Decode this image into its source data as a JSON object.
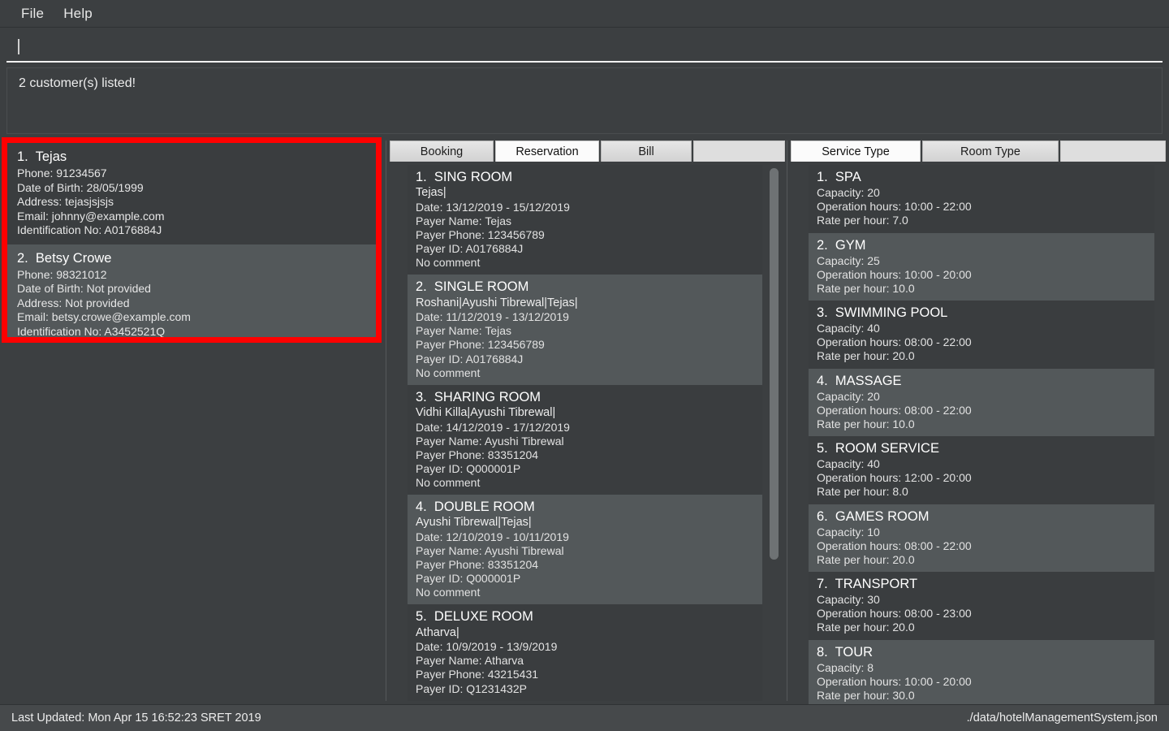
{
  "menubar": {
    "items": [
      "File",
      "Help"
    ]
  },
  "command": {
    "value": "",
    "placeholder": ""
  },
  "message": {
    "text": "2 customer(s) listed!"
  },
  "customer_panel": {
    "selected": true,
    "highlight_color": "#ff0000",
    "customers": [
      {
        "title": "1.  Tejas",
        "phone": "Phone: 91234567",
        "dob": "Date of Birth: 28/05/1999",
        "address": "Address: tejasjsjsjs",
        "email": "Email: johnny@example.com",
        "id": "Identification No: A0176884J"
      },
      {
        "title": "2.  Betsy Crowe",
        "phone": "Phone: 98321012",
        "dob": "Date of Birth: Not provided",
        "address": "Address: Not provided",
        "email": "Email: betsy.crowe@example.com",
        "id": "Identification No: A3452521Q"
      }
    ]
  },
  "middle_panel": {
    "tabs": [
      {
        "label": "Booking",
        "selected": false
      },
      {
        "label": "Reservation",
        "selected": true
      },
      {
        "label": "Bill",
        "selected": false
      }
    ],
    "reservations": [
      {
        "title": "1.  SING ROOM",
        "occupants": "Tejas|",
        "date": "Date: 13/12/2019 - 15/12/2019",
        "payer_name": "Payer Name: Tejas",
        "payer_phone": "Payer Phone: 123456789",
        "payer_id": "Payer ID: A0176884J",
        "comment": "No comment"
      },
      {
        "title": "2.  SINGLE ROOM",
        "occupants": "Roshani|Ayushi Tibrewal|Tejas|",
        "date": "Date: 11/12/2019 - 13/12/2019",
        "payer_name": "Payer Name: Tejas",
        "payer_phone": "Payer Phone: 123456789",
        "payer_id": "Payer ID: A0176884J",
        "comment": "No comment"
      },
      {
        "title": "3.  SHARING ROOM",
        "occupants": "Vidhi Killa|Ayushi Tibrewal|",
        "date": "Date: 14/12/2019 - 17/12/2019",
        "payer_name": "Payer Name: Ayushi Tibrewal",
        "payer_phone": "Payer Phone: 83351204",
        "payer_id": "Payer ID: Q000001P",
        "comment": "No comment"
      },
      {
        "title": "4.  DOUBLE ROOM",
        "occupants": "Ayushi Tibrewal|Tejas|",
        "date": "Date: 12/10/2019 - 10/11/2019",
        "payer_name": "Payer Name: Ayushi Tibrewal",
        "payer_phone": "Payer Phone: 83351204",
        "payer_id": "Payer ID: Q000001P",
        "comment": "No comment"
      },
      {
        "title": "5.  DELUXE ROOM",
        "occupants": "Atharva|",
        "date": "Date: 10/9/2019 - 13/9/2019",
        "payer_name": "Payer Name: Atharva",
        "payer_phone": "Payer Phone: 43215431",
        "payer_id": "Payer ID: Q1231432P",
        "comment": ""
      }
    ]
  },
  "right_panel": {
    "tabs": [
      {
        "label": "Service Type",
        "selected": true
      },
      {
        "label": "Room Type",
        "selected": false
      }
    ],
    "services": [
      {
        "title": "1.  SPA",
        "capacity": "Capacity: 20",
        "hours": "Operation hours: 10:00 - 22:00",
        "rate": "Rate per hour: 7.0"
      },
      {
        "title": "2.  GYM",
        "capacity": "Capacity: 25",
        "hours": "Operation hours: 10:00 - 20:00",
        "rate": "Rate per hour: 10.0"
      },
      {
        "title": "3.  SWIMMING POOL",
        "capacity": "Capacity: 40",
        "hours": "Operation hours: 08:00 - 22:00",
        "rate": "Rate per hour: 20.0"
      },
      {
        "title": "4.  MASSAGE",
        "capacity": "Capacity: 20",
        "hours": "Operation hours: 08:00 - 22:00",
        "rate": "Rate per hour: 10.0"
      },
      {
        "title": "5.  ROOM SERVICE",
        "capacity": "Capacity: 40",
        "hours": "Operation hours: 12:00 - 20:00",
        "rate": "Rate per hour: 8.0"
      },
      {
        "title": "6.  GAMES ROOM",
        "capacity": "Capacity: 10",
        "hours": "Operation hours: 08:00 - 22:00",
        "rate": "Rate per hour: 20.0"
      },
      {
        "title": "7.  TRANSPORT",
        "capacity": "Capacity: 30",
        "hours": "Operation hours: 08:00 - 23:00",
        "rate": "Rate per hour: 20.0"
      },
      {
        "title": "8.  TOUR",
        "capacity": "Capacity: 8",
        "hours": "Operation hours: 10:00 - 20:00",
        "rate": "Rate per hour: 30.0"
      }
    ]
  },
  "statusbar": {
    "last_updated": "Last Updated: Mon Apr 15 16:52:23 SRET 2019",
    "file_path": "./data/hotelManagementSystem.json"
  }
}
